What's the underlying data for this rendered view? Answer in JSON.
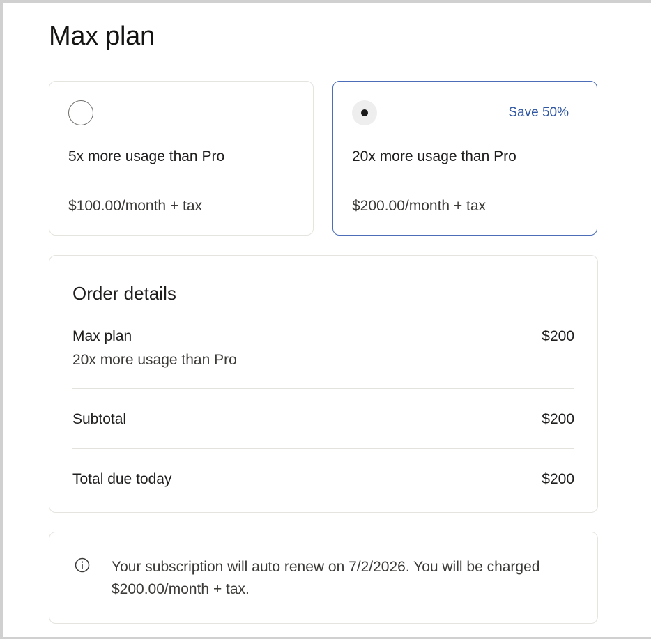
{
  "page": {
    "title": "Max plan"
  },
  "plans": [
    {
      "usage": "5x more usage than Pro",
      "price": "$100.00/month + tax",
      "selected": false
    },
    {
      "usage": "20x more usage than Pro",
      "price": "$200.00/month + tax",
      "badge": "Save 50%",
      "selected": true
    }
  ],
  "order": {
    "title": "Order details",
    "item_name": "Max plan",
    "item_desc": "20x more usage than Pro",
    "item_price": "$200",
    "subtotal_label": "Subtotal",
    "subtotal_value": "$200",
    "total_label": "Total due today",
    "total_value": "$200"
  },
  "notice": {
    "icon": "info-icon",
    "text": "Your subscription will auto renew on 7/2/2026. You will be charged $200.00/month + tax."
  },
  "colors": {
    "accent": "#2f56a3",
    "selected_border": "#4d6db8",
    "card_border": "#e6e4df"
  }
}
